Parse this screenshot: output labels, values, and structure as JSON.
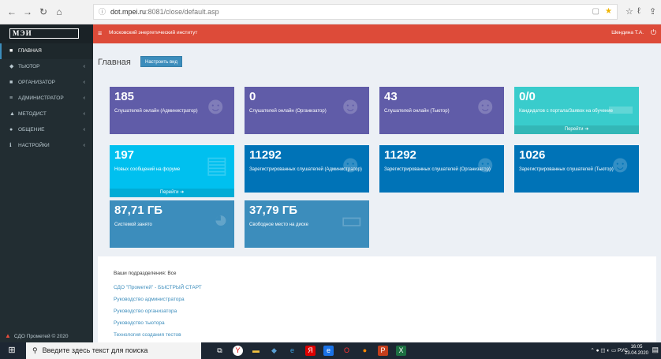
{
  "browser": {
    "url_host": "dot.mpei.ru",
    "url_rest": ":8081/close/default.asp",
    "back_icon": "←",
    "fwd_icon": "→",
    "reload_icon": "↻",
    "home_icon": "⌂"
  },
  "logo": "МЭИ",
  "sidebar": {
    "items": [
      {
        "label": "ГЛАВНАЯ",
        "icon": "■"
      },
      {
        "label": "ТЬЮТОР",
        "icon": "◆"
      },
      {
        "label": "ОРГАНИЗАТОР",
        "icon": "■"
      },
      {
        "label": "АДМИНИСТРАТОР",
        "icon": "≡"
      },
      {
        "label": "МЕТОДИСТ",
        "icon": "▲"
      },
      {
        "label": "ОБЩЕНИЕ",
        "icon": "●"
      },
      {
        "label": "НАСТРОЙКИ",
        "icon": "ℹ"
      }
    ],
    "caret": "‹",
    "copyright": "СДО Прометей © 2020"
  },
  "topbar": {
    "org": "Московский энергетический институт",
    "user": "Шендина Т.А."
  },
  "main": {
    "title": "Главная",
    "configure_button": "Настроить вид",
    "boxes": [
      {
        "value": "185",
        "label": "Слушателей онлайн (Администратор)",
        "color": "#605ca8"
      },
      {
        "value": "0",
        "label": "Слушателей онлайн (Организатор)",
        "color": "#605ca8"
      },
      {
        "value": "43",
        "label": "Слушателей онлайн (Тьютор)",
        "color": "#605ca8"
      },
      {
        "value": "0/0",
        "label": "Кандидатов с портала/Заявок на обучение",
        "more": "Перейти",
        "color": "#39cccc"
      },
      {
        "value": "197",
        "label": "Новых сообщений на форуме",
        "more": "Перейти",
        "color": "#00c0ef"
      },
      {
        "value": "11292",
        "label": "Зарегистрированных слушателей (Администратор)",
        "color": "#0073b7"
      },
      {
        "value": "11292",
        "label": "Зарегистрированных слушателей (Организатор)",
        "color": "#0073b7"
      },
      {
        "value": "1026",
        "label": "Зарегистрированных слушателей (Тьютор)",
        "color": "#0073b7"
      },
      {
        "value": "87,71 ГБ",
        "label": "Системой занято",
        "color": "#3c8dbc"
      },
      {
        "value": "37,79 ГБ",
        "label": "Свободное место на диске",
        "color": "#3c8dbc"
      }
    ],
    "subdivisions": "Ваши подразделения: Все",
    "links": [
      "СДО \"Прометей\" - БЫСТРЫЙ СТАРТ",
      "Руководство администратора",
      "Руководство организатора",
      "Руководство тьютора",
      "Технология создания тестов"
    ]
  },
  "taskbar": {
    "search_placeholder": "Введите здесь текст для поиска",
    "lang": "РУС",
    "time": "16:05",
    "date": "23.04.2020"
  }
}
